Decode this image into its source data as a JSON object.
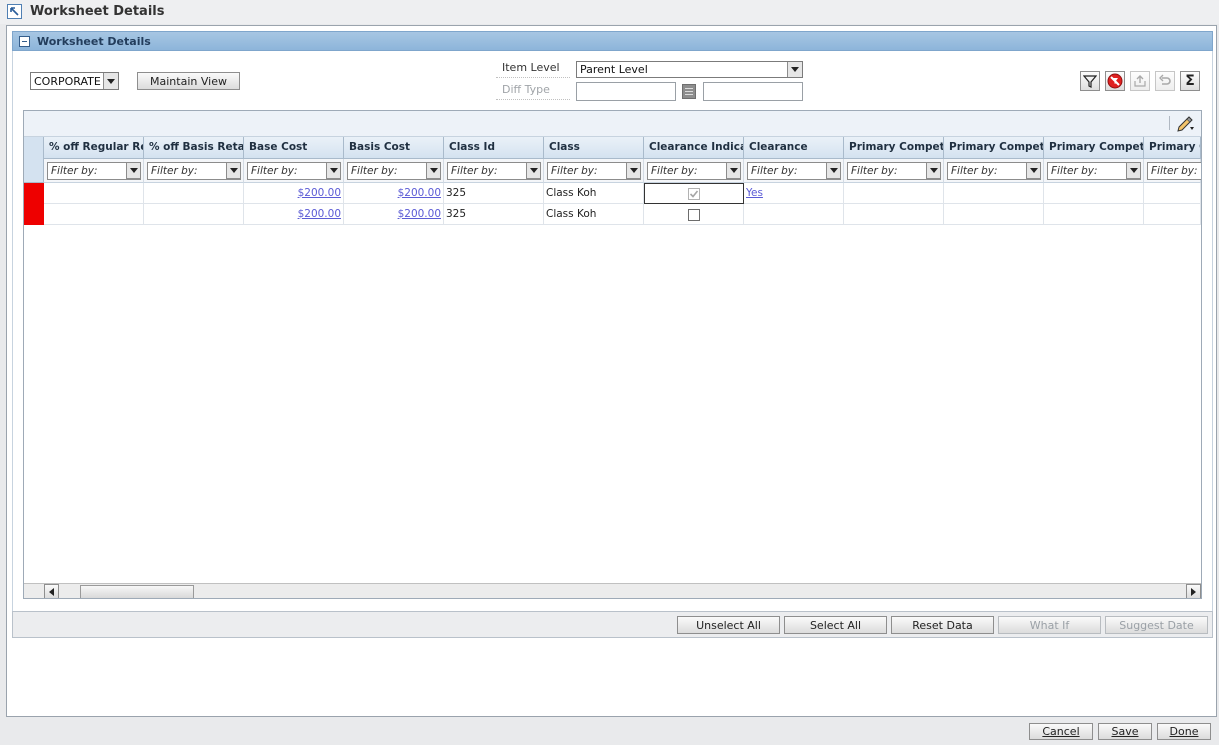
{
  "window": {
    "title": "Worksheet Details"
  },
  "section": {
    "title": "Worksheet Details"
  },
  "view": {
    "selected": "CORPORATE",
    "maintain_label": "Maintain View"
  },
  "item_level": {
    "label": "Item Level",
    "value": "Parent Level"
  },
  "diff_type": {
    "label": "Diff Type",
    "value": "",
    "value2": ""
  },
  "toolbar_icons": [
    "filter-icon",
    "clear-filter-icon",
    "export-icon",
    "undo-icon",
    "sum-icon"
  ],
  "grid": {
    "columns": [
      "% off Regular Retail",
      "% off Basis Retail",
      "Base Cost",
      "Basis Cost",
      "Class Id",
      "Class",
      "Clearance Indicator",
      "Clearance",
      "Primary Competitor",
      "Primary Competitor",
      "Primary Competitor",
      "Primary Competitor"
    ],
    "filter_placeholder": "Filter by:",
    "rows": [
      {
        "pct_reg": "",
        "pct_basis": "",
        "base_cost": "$200.00",
        "basis_cost": "$200.00",
        "class_id": "325",
        "class": "Class Koh",
        "clearance_indicator": true,
        "clearance_indicator_enabled": false,
        "clearance": "Yes"
      },
      {
        "pct_reg": "",
        "pct_basis": "",
        "base_cost": "$200.00",
        "basis_cost": "$200.00",
        "class_id": "325",
        "class": "Class Koh",
        "clearance_indicator": false,
        "clearance_indicator_enabled": true,
        "clearance": ""
      }
    ]
  },
  "actions": {
    "unselect_all": "Unselect All",
    "select_all": "Select All",
    "reset_data": "Reset Data",
    "what_if": "What If",
    "suggest_date": "Suggest Date"
  },
  "footer": {
    "cancel": "Cancel",
    "save": "Save",
    "done": "Done"
  },
  "colors": {
    "marker": "#ee0000",
    "link": "#5b5bd6",
    "section_header": "#8db5da"
  }
}
